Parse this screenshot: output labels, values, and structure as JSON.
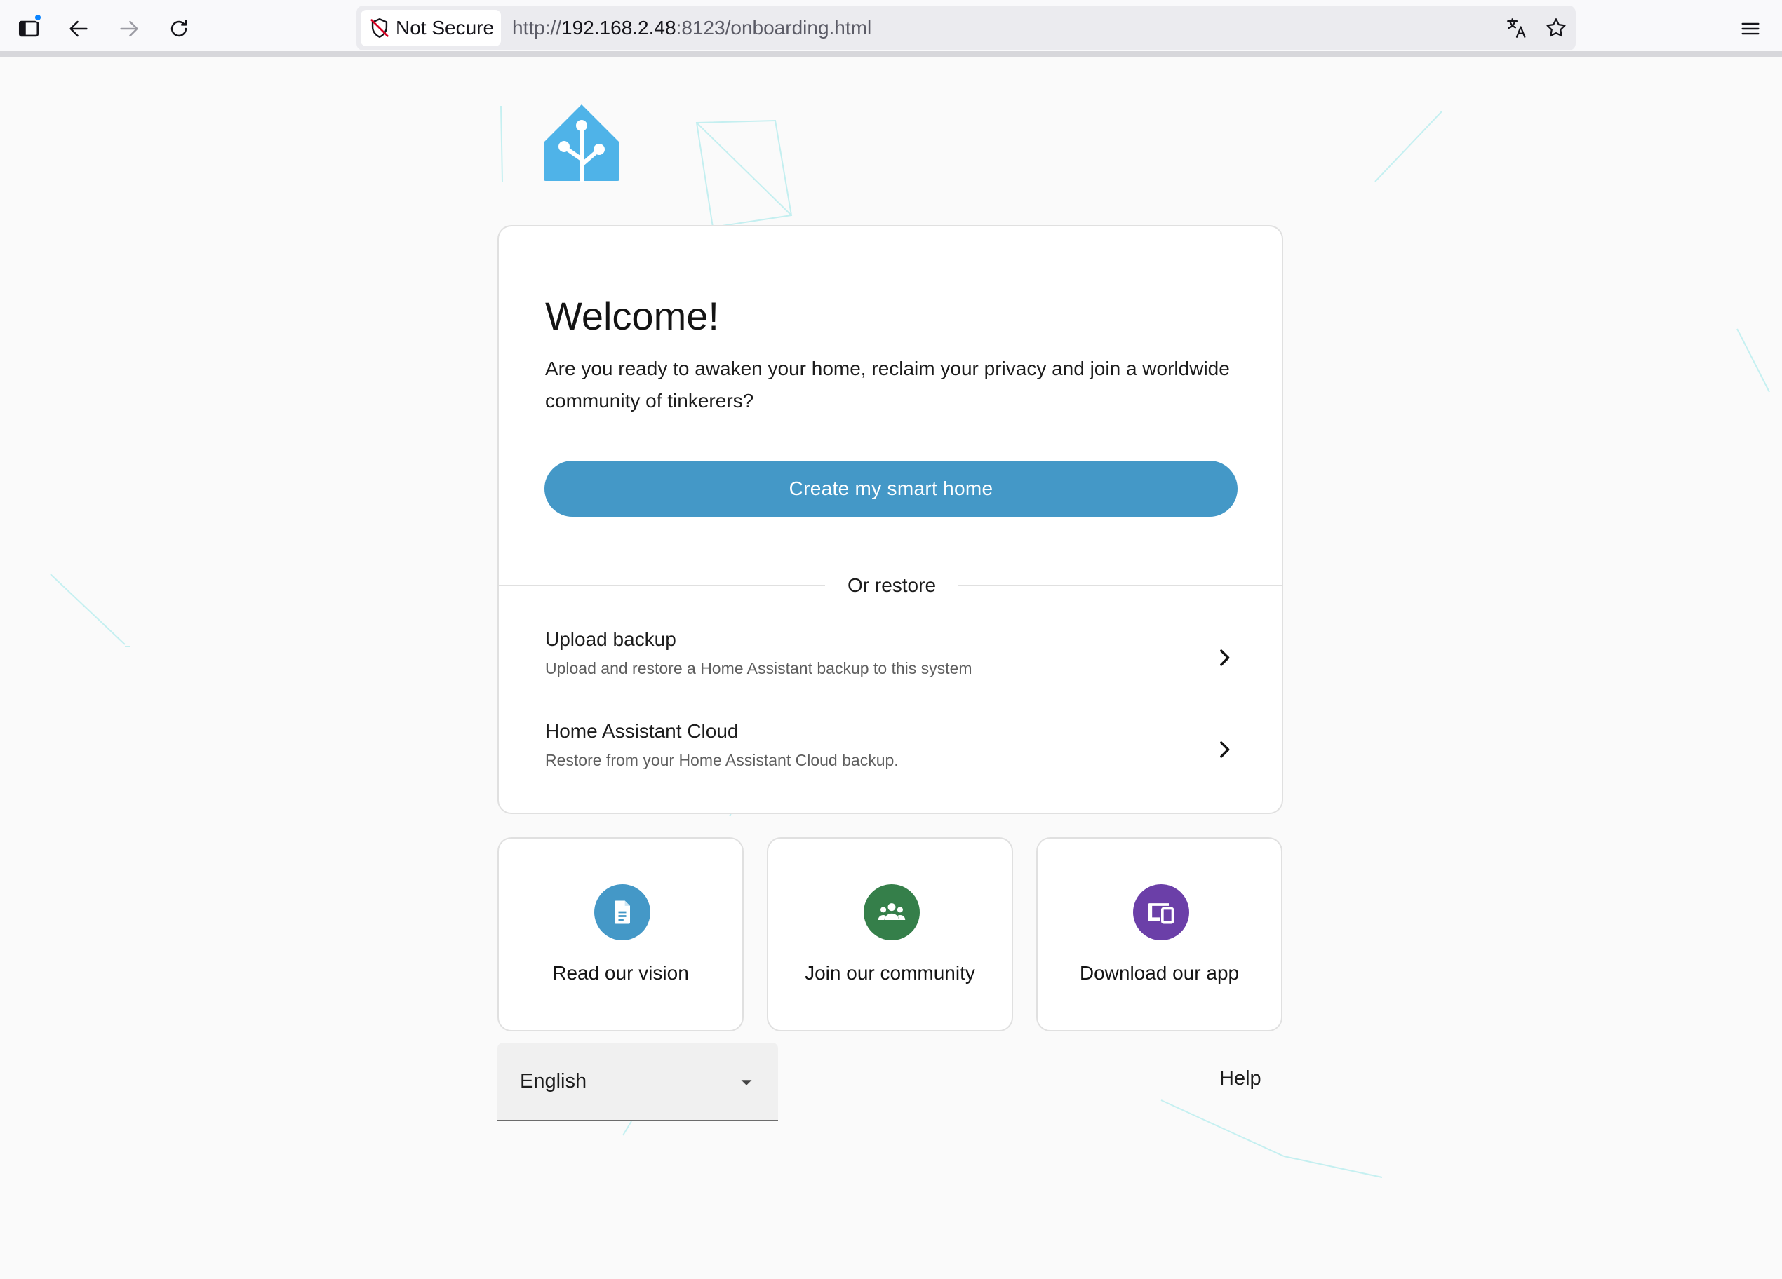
{
  "browser": {
    "security_label": "Not Secure",
    "url_scheme": "http://",
    "url_host": "192.168.2.48",
    "url_rest": ":8123/onboarding.html"
  },
  "welcome": {
    "title": "Welcome!",
    "text": "Are you ready to awaken your home, reclaim your privacy and join a worldwide community of tinkerers?",
    "create_button": "Create my smart home",
    "or_restore": "Or restore"
  },
  "restore_options": [
    {
      "title": "Upload backup",
      "description": "Upload and restore a Home Assistant backup to this system"
    },
    {
      "title": "Home Assistant Cloud",
      "description": "Restore from your Home Assistant Cloud backup."
    }
  ],
  "links": [
    {
      "label": "Read our vision",
      "icon": "document-icon",
      "color": "#4498c7"
    },
    {
      "label": "Join our community",
      "icon": "group-icon",
      "color": "#357f4a"
    },
    {
      "label": "Download our app",
      "icon": "devices-icon",
      "color": "#6b3fa8"
    }
  ],
  "footer": {
    "language": "English",
    "help": "Help"
  },
  "colors": {
    "primary": "#4498c7",
    "logo": "#4fb3e8"
  }
}
